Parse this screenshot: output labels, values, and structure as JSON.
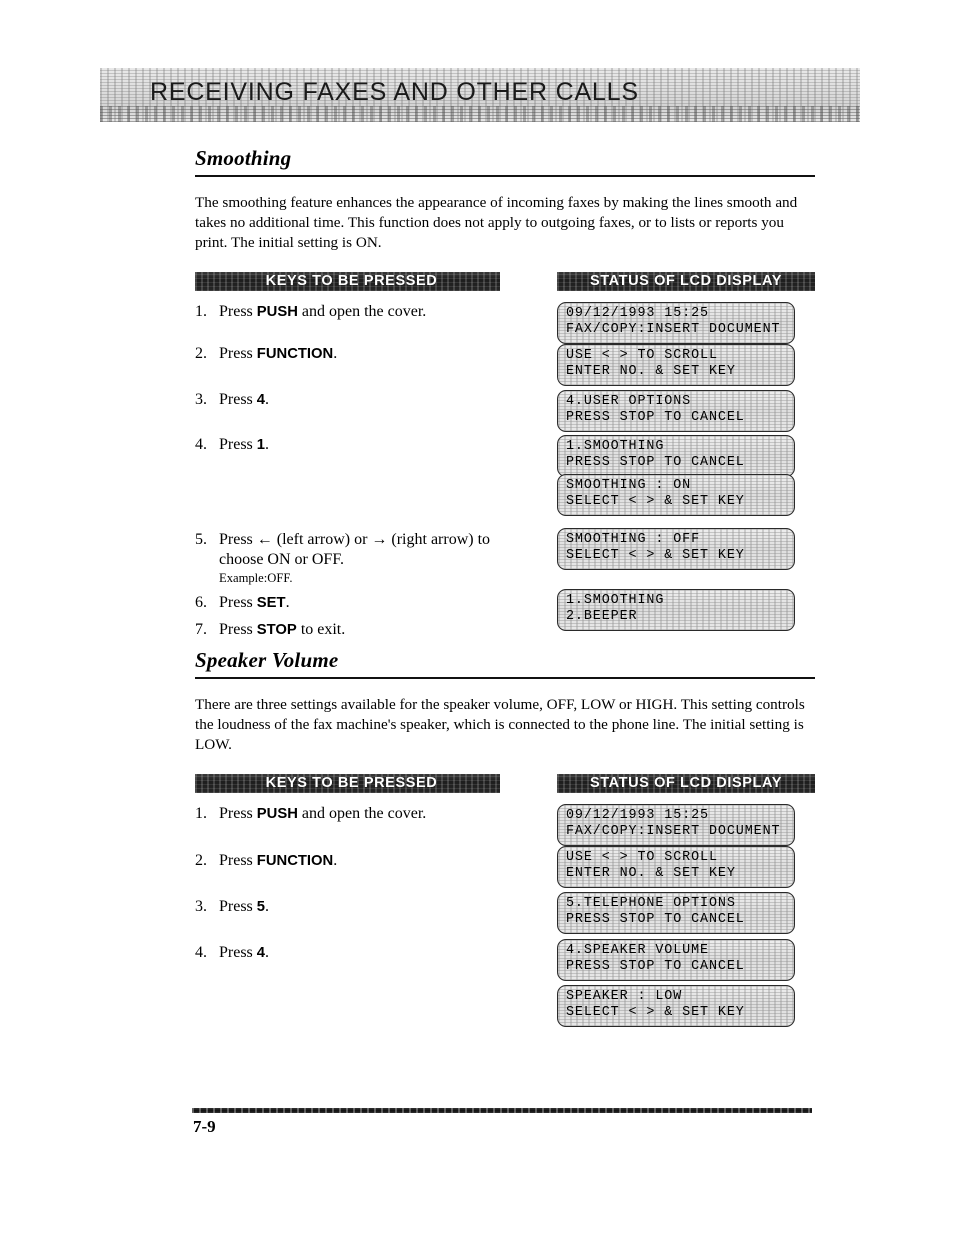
{
  "running_head": "RECEIVING FAXES AND OTHER CALLS",
  "column_headers": {
    "keys": "KEYS TO BE PRESSED",
    "status": "STATUS OF LCD DISPLAY"
  },
  "sections": [
    {
      "heading": "Smoothing",
      "body": "The smoothing feature enhances the appearance of incoming faxes by making the lines smooth and takes no additional time. This function does not apply to outgoing faxes, or to lists or reports you print. The initial setting is ON.",
      "steps": [
        {
          "num": "1.",
          "pre": "Press ",
          "key": "PUSH",
          "post": " and open the cover.",
          "sub": ""
        },
        {
          "num": "2.",
          "pre": "Press ",
          "key": "FUNCTION",
          "post": ".",
          "sub": ""
        },
        {
          "num": "3.",
          "pre": "Press ",
          "key": "4",
          "post": ".",
          "sub": ""
        },
        {
          "num": "4.",
          "pre": "Press ",
          "key": "1",
          "post": ".",
          "sub": ""
        },
        {
          "num": "5.",
          "pre": "Press ← (left arrow) or → (right arrow) to choose ON or OFF.",
          "key": "",
          "post": "",
          "sub": "Example:OFF."
        },
        {
          "num": "6.",
          "pre": "Press ",
          "key": "SET",
          "post": ".",
          "sub": ""
        },
        {
          "num": "7.",
          "pre": "Press ",
          "key": "STOP",
          "post": " to exit.",
          "sub": ""
        }
      ],
      "displays": [
        {
          "line1": "09/12/1993 15:25",
          "line2": "FAX/COPY:INSERT DOCUMENT"
        },
        {
          "line1": "USE < > TO SCROLL",
          "line2": "ENTER NO. & SET KEY"
        },
        {
          "line1": "4.USER OPTIONS",
          "line2": "PRESS STOP TO CANCEL"
        },
        {
          "line1": "1.SMOOTHING",
          "line2": "PRESS STOP TO CANCEL"
        },
        {
          "line1": "SMOOTHING : ON",
          "line2": "SELECT < > & SET KEY"
        },
        {
          "line1": "SMOOTHING : OFF",
          "line2": "SELECT < > & SET KEY"
        },
        {
          "line1": "1.SMOOTHING",
          "line2": "2.BEEPER"
        }
      ]
    },
    {
      "heading": "Speaker Volume",
      "body": "There are three settings available for the speaker volume, OFF, LOW or HIGH. This setting controls the loudness of the fax machine's speaker, which is connected to the phone line. The initial setting is LOW.",
      "steps": [
        {
          "num": "1.",
          "pre": "Press ",
          "key": "PUSH",
          "post": " and open the cover.",
          "sub": ""
        },
        {
          "num": "2.",
          "pre": "Press ",
          "key": "FUNCTION",
          "post": ".",
          "sub": ""
        },
        {
          "num": "3.",
          "pre": "Press ",
          "key": "5",
          "post": ".",
          "sub": ""
        },
        {
          "num": "4.",
          "pre": "Press ",
          "key": "4",
          "post": ".",
          "sub": ""
        }
      ],
      "displays": [
        {
          "line1": "09/12/1993 15:25",
          "line2": "FAX/COPY:INSERT DOCUMENT"
        },
        {
          "line1": "USE < > TO SCROLL",
          "line2": "ENTER NO. & SET KEY"
        },
        {
          "line1": "5.TELEPHONE OPTIONS",
          "line2": "PRESS STOP TO CANCEL"
        },
        {
          "line1": "4.SPEAKER VOLUME",
          "line2": "PRESS STOP TO CANCEL"
        },
        {
          "line1": "SPEAKER : LOW",
          "line2": "SELECT < > & SET KEY"
        }
      ]
    }
  ],
  "footer": {
    "page_number": "7-9"
  },
  "layout": {
    "section1": {
      "step_tops": [
        0,
        42,
        88,
        133,
        228,
        291,
        318
      ],
      "lcd_tops": [
        0,
        42,
        88,
        133,
        172,
        226,
        287
      ]
    },
    "section2": {
      "step_tops": [
        0,
        47,
        93,
        139
      ],
      "lcd_tops": [
        0,
        42,
        88,
        135,
        181
      ]
    }
  }
}
